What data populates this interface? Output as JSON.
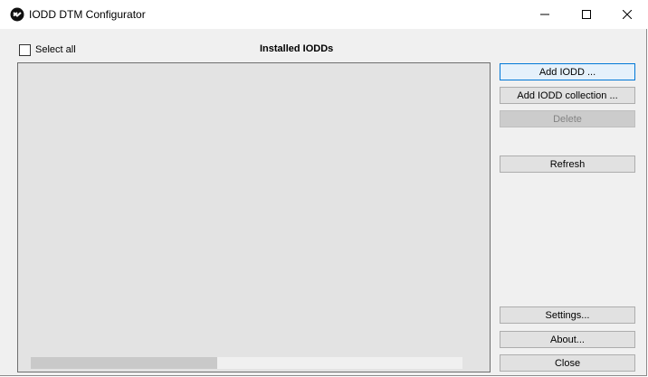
{
  "window": {
    "title": "IODD DTM Configurator"
  },
  "select_all_label": "Select all",
  "list": {
    "heading": "Installed IODDs"
  },
  "buttons": {
    "add_iodd": "Add IODD ...",
    "add_collection": "Add IODD collection ...",
    "delete": "Delete",
    "refresh": "Refresh",
    "settings": "Settings...",
    "about": "About...",
    "close": "Close"
  },
  "colors": {
    "primary_border": "#0078d7",
    "list_background": "#e3e3e3"
  }
}
